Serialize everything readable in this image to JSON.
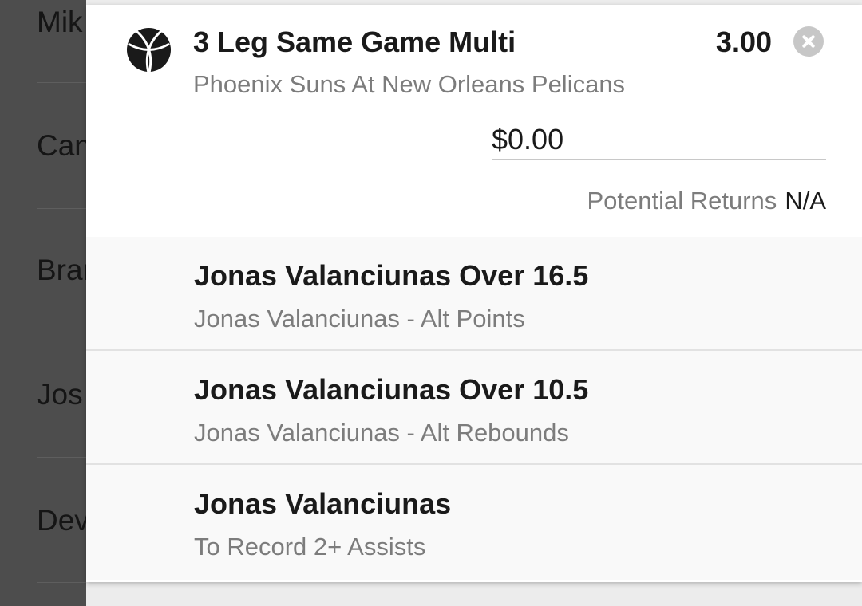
{
  "background_list": {
    "items": [
      "Mik",
      "Can",
      "Bran",
      "Jos",
      "Dev"
    ]
  },
  "bet": {
    "icon": "basketball-icon",
    "title": "3 Leg Same Game Multi",
    "odds": "3.00",
    "event": "Phoenix Suns At New Orleans Pelicans",
    "stake_value": "$0.00",
    "returns_label": "Potential Returns",
    "returns_value": "N/A",
    "legs": [
      {
        "title": "Jonas Valanciunas Over 16.5",
        "market": "Jonas Valanciunas - Alt Points"
      },
      {
        "title": "Jonas Valanciunas Over 10.5",
        "market": "Jonas Valanciunas - Alt Rebounds"
      },
      {
        "title": "Jonas Valanciunas",
        "market": "To Record 2+ Assists"
      }
    ]
  },
  "colors": {
    "overlay": "#4d4d4d",
    "panel": "#ffffff",
    "leg_background": "#f9f9f9",
    "primary_text": "#1a1a1a",
    "secondary_text": "#7c7c7c",
    "close_button": "#c7c7c7"
  }
}
